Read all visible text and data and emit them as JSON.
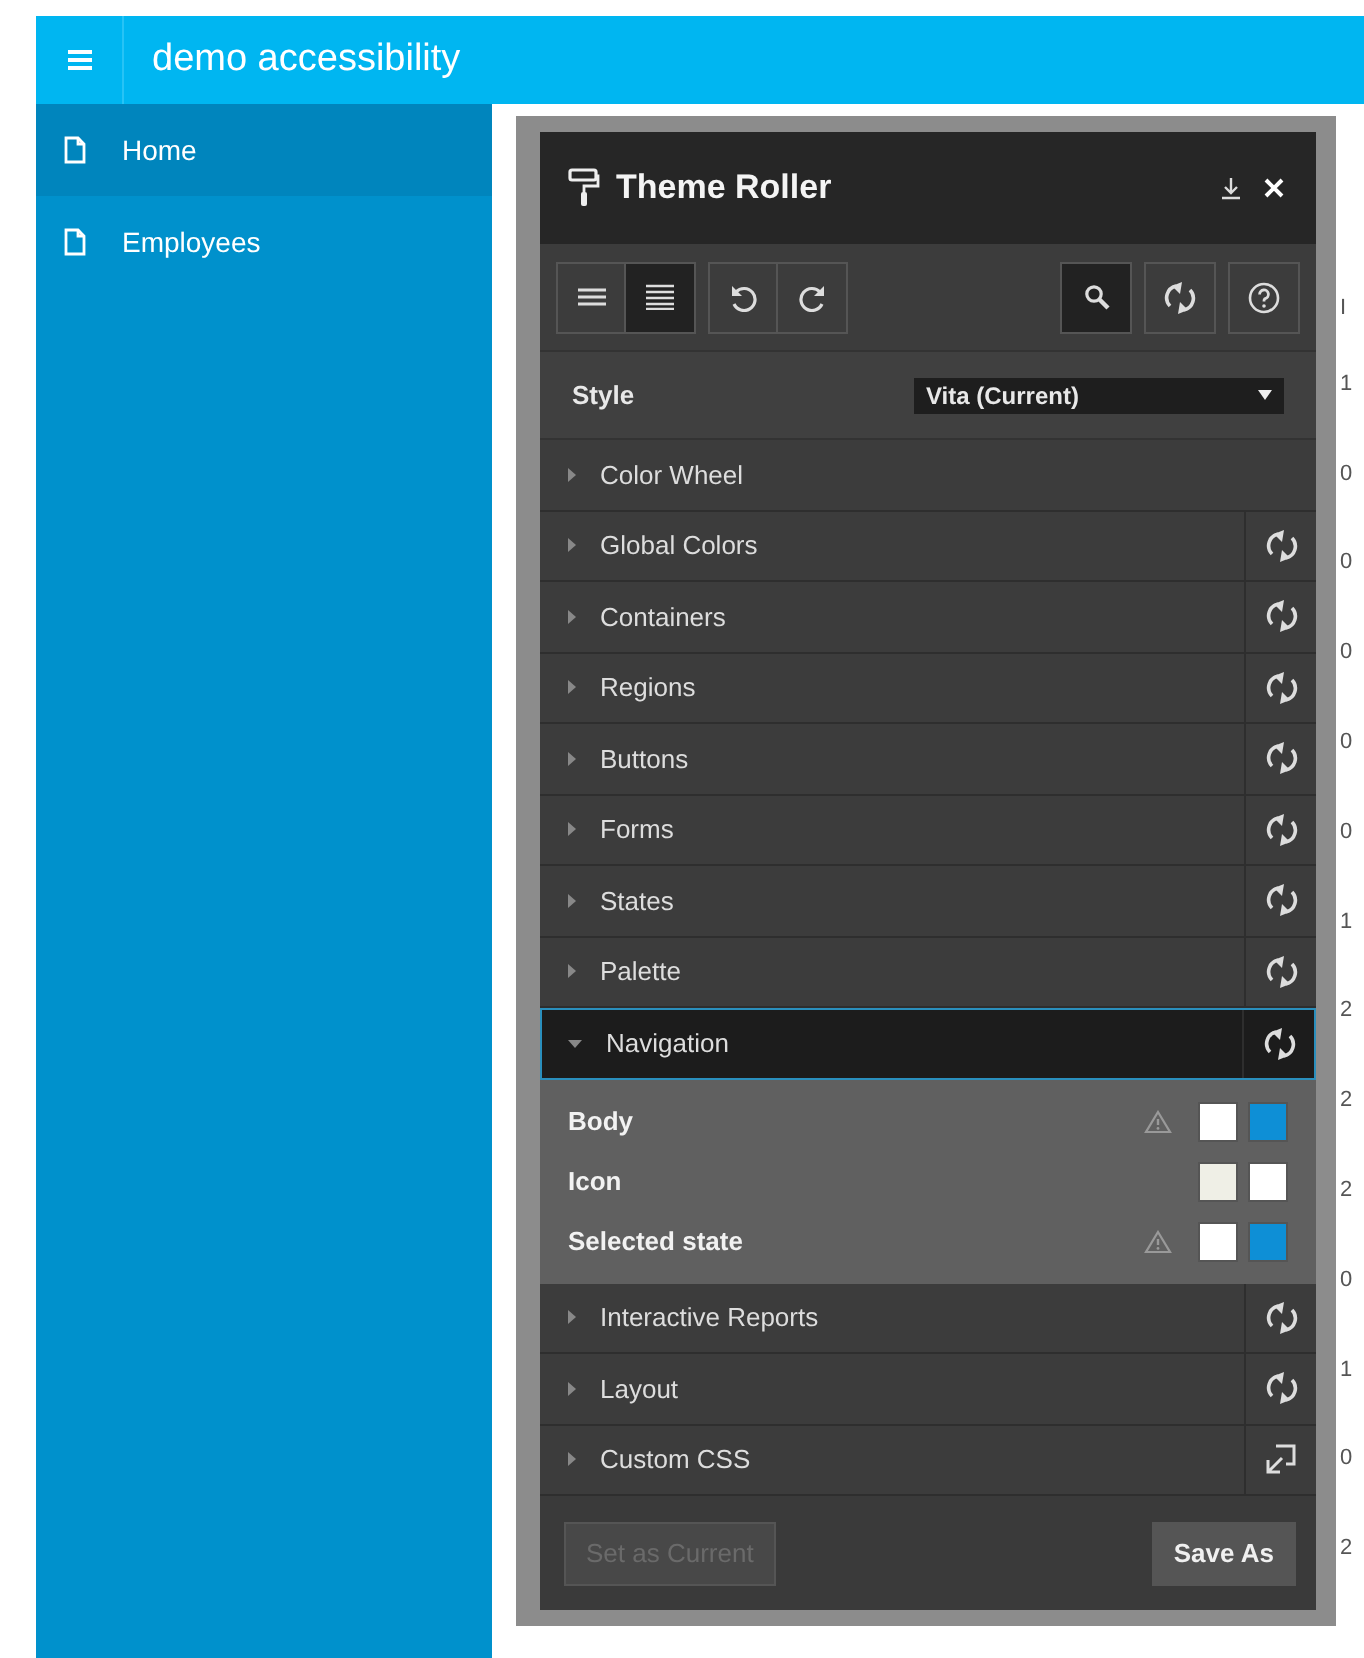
{
  "app_bar": {
    "title": "demo accessibility"
  },
  "sidebar": {
    "items": [
      {
        "label": "Home",
        "selected": true
      },
      {
        "label": "Employees",
        "selected": false
      }
    ]
  },
  "table": {
    "header": "I",
    "column_1": [
      "1",
      "0",
      "0",
      "0",
      "0",
      "0",
      "1",
      "2",
      "2",
      "2",
      "0",
      "1",
      "0",
      "2"
    ]
  },
  "theme_roller": {
    "title": "Theme Roller",
    "toolbar": [
      {
        "kind": "list-compact",
        "selected": false
      },
      {
        "kind": "list-full",
        "selected": true
      },
      {
        "kind": "undo",
        "selected": false
      },
      {
        "kind": "redo",
        "selected": false
      },
      {
        "kind": "search",
        "selected": true
      },
      {
        "kind": "reset",
        "selected": false
      },
      {
        "kind": "help",
        "selected": false
      }
    ],
    "style": {
      "label": "Style",
      "value": "Vita (Current)"
    },
    "sections": [
      {
        "label": "Color Wheel",
        "expanded": false,
        "kind": "plain"
      },
      {
        "label": "Global Colors",
        "expanded": false,
        "kind": "reset"
      },
      {
        "label": "Containers",
        "expanded": false,
        "kind": "reset"
      },
      {
        "label": "Regions",
        "expanded": false,
        "kind": "reset"
      },
      {
        "label": "Buttons",
        "expanded": false,
        "kind": "reset"
      },
      {
        "label": "Forms",
        "expanded": false,
        "kind": "reset"
      },
      {
        "label": "States",
        "expanded": false,
        "kind": "reset"
      },
      {
        "label": "Palette",
        "expanded": false,
        "kind": "reset"
      },
      {
        "label": "Navigation",
        "expanded": true,
        "kind": "reset",
        "properties": [
          {
            "label": "Body",
            "warning": true,
            "swatches": [
              {
                "color": "#ffffff"
              },
              {
                "color": "#0e8fd6"
              }
            ]
          },
          {
            "label": "Icon",
            "warning": false,
            "swatches": [
              {
                "color": "#efefe6"
              },
              {
                "color": "#ffffff"
              }
            ]
          },
          {
            "label": "Selected state",
            "warning": true,
            "swatches": [
              {
                "color": "#ffffff"
              },
              {
                "color": "#0e8fd6"
              }
            ]
          }
        ]
      },
      {
        "label": "Interactive Reports",
        "expanded": false,
        "kind": "reset"
      },
      {
        "label": "Layout",
        "expanded": false,
        "kind": "reset"
      },
      {
        "label": "Custom CSS",
        "expanded": false,
        "kind": "open"
      }
    ],
    "buttons": [
      {
        "label": "Set as Current",
        "disabled": true
      },
      {
        "label": "Save As",
        "disabled": false
      }
    ]
  }
}
